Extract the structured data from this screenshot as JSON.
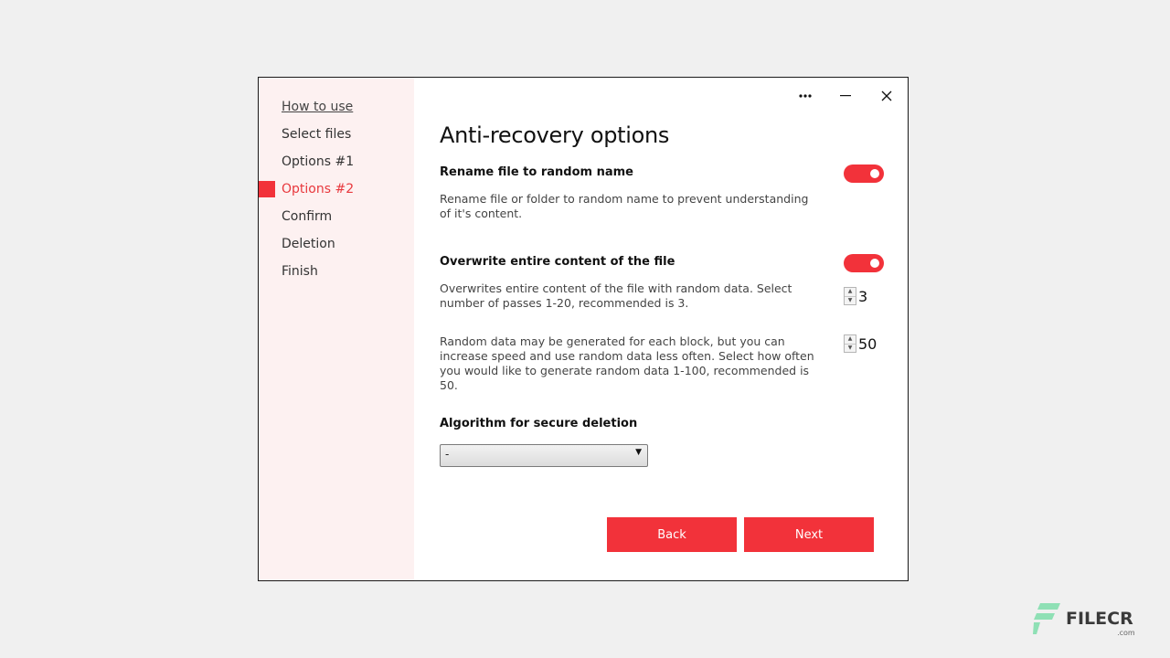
{
  "sidebar": {
    "items": [
      {
        "label": "How to use"
      },
      {
        "label": "Select files"
      },
      {
        "label": "Options #1"
      },
      {
        "label": "Options #2"
      },
      {
        "label": "Confirm"
      },
      {
        "label": "Deletion"
      },
      {
        "label": "Finish"
      }
    ],
    "active_index": 3
  },
  "titlebar": {
    "more_label": "•••",
    "minimize_label": "—",
    "close_label": "✕"
  },
  "main": {
    "title": "Anti-recovery options",
    "rename": {
      "heading": "Rename file to random name",
      "description": "Rename file or folder to random name to prevent understanding of it's content.",
      "enabled": true
    },
    "overwrite": {
      "heading": "Overwrite entire content of the file",
      "enabled": true,
      "passes_description": "Overwrites entire content of the file with random data. Select number of passes 1-20, recommended is 3.",
      "passes_value": "3",
      "random_description": "Random data may be generated for each block, but you can increase speed and use random data less often. Select how often you would like to generate random data 1-100, recommended is 50.",
      "random_value": "50"
    },
    "algorithm": {
      "heading": "Algorithm for secure deletion",
      "selected": "-"
    },
    "buttons": {
      "back": "Back",
      "next": "Next"
    }
  },
  "watermark": {
    "text": "FILECR",
    "sub": ".com"
  },
  "colors": {
    "accent": "#f2323a",
    "sidebar_bg": "#fdf1f1",
    "page_bg": "#f0f0f0",
    "active_text": "#e8383d"
  },
  "icons": {
    "more": "more-dots-icon",
    "minimize": "minimize-icon",
    "close": "close-icon",
    "dropdown": "chevron-down-icon",
    "spin_up": "spin-up-icon",
    "spin_down": "spin-down-icon",
    "logo": "filecr-logo-icon"
  }
}
